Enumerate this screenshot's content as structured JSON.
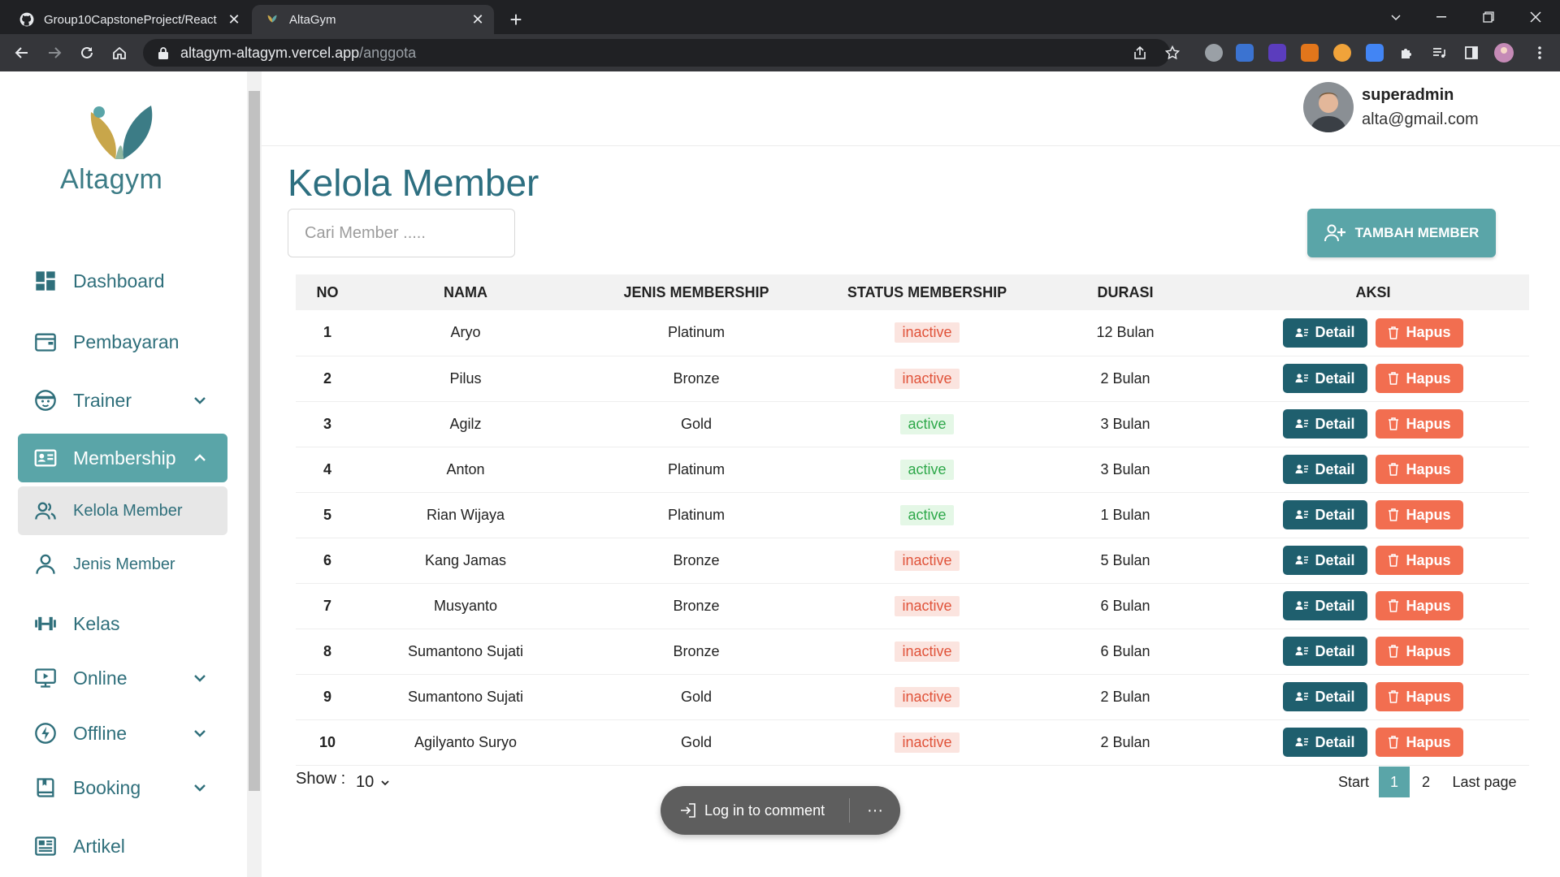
{
  "browser": {
    "tabs": [
      {
        "title": "Group10CapstoneProject/React",
        "active": false
      },
      {
        "title": "AltaGym",
        "active": true
      }
    ],
    "url_host": "altagym-altagym.vercel.app",
    "url_path": "/anggota"
  },
  "sidebar": {
    "brand": "Altagym",
    "items": [
      {
        "label": "Dashboard",
        "icon": "dashboard-icon"
      },
      {
        "label": "Pembayaran",
        "icon": "wallet-icon"
      },
      {
        "label": "Trainer",
        "icon": "trainer-face-icon"
      },
      {
        "label": "Membership",
        "icon": "id-card-icon"
      },
      {
        "label": "Kelola Member",
        "icon": "users-icon"
      },
      {
        "label": "Jenis Member",
        "icon": "user-icon"
      },
      {
        "label": "Kelas",
        "icon": "dumbbell-icon"
      },
      {
        "label": "Online",
        "icon": "monitor-icon"
      },
      {
        "label": "Offline",
        "icon": "bolt-icon"
      },
      {
        "label": "Booking",
        "icon": "book-icon"
      },
      {
        "label": "Artikel",
        "icon": "newspaper-icon"
      }
    ]
  },
  "user": {
    "name": "superadmin",
    "email": "alta@gmail.com"
  },
  "page": {
    "title": "Kelola Member",
    "search_placeholder": "Cari Member .....",
    "add_button": "TAMBAH MEMBER"
  },
  "table": {
    "headers": [
      "NO",
      "NAMA",
      "JENIS MEMBERSHIP",
      "STATUS MEMBERSHIP",
      "DURASI",
      "AKSI"
    ],
    "detail_label": "Detail",
    "hapus_label": "Hapus",
    "rows": [
      {
        "no": "1",
        "nama": "Aryo",
        "jenis": "Platinum",
        "status": "inactive",
        "durasi": "12 Bulan"
      },
      {
        "no": "2",
        "nama": "Pilus",
        "jenis": "Bronze",
        "status": "inactive",
        "durasi": "2 Bulan"
      },
      {
        "no": "3",
        "nama": "Agilz",
        "jenis": "Gold",
        "status": "active",
        "durasi": "3 Bulan"
      },
      {
        "no": "4",
        "nama": "Anton",
        "jenis": "Platinum",
        "status": "active",
        "durasi": "3 Bulan"
      },
      {
        "no": "5",
        "nama": "Rian Wijaya",
        "jenis": "Platinum",
        "status": "active",
        "durasi": "1 Bulan"
      },
      {
        "no": "6",
        "nama": "Kang Jamas",
        "jenis": "Bronze",
        "status": "inactive",
        "durasi": "5 Bulan"
      },
      {
        "no": "7",
        "nama": "Musyanto",
        "jenis": "Bronze",
        "status": "inactive",
        "durasi": "6 Bulan"
      },
      {
        "no": "8",
        "nama": "Sumantono Sujati",
        "jenis": "Bronze",
        "status": "inactive",
        "durasi": "6 Bulan"
      },
      {
        "no": "9",
        "nama": "Sumantono Sujati",
        "jenis": "Gold",
        "status": "inactive",
        "durasi": "2 Bulan"
      },
      {
        "no": "10",
        "nama": "Agilyanto Suryo",
        "jenis": "Gold",
        "status": "inactive",
        "durasi": "2 Bulan"
      }
    ]
  },
  "footer": {
    "show_label": "Show :",
    "show_value": "10",
    "pagination": {
      "start": "Start",
      "pages": [
        "1",
        "2"
      ],
      "current": "1",
      "last": "Last page"
    }
  },
  "comment": {
    "label": "Log in to comment",
    "more": "···"
  },
  "colors": {
    "accent": "#5aa5a8",
    "primary_dark": "#1f5f6e",
    "danger": "#f26e50",
    "title": "#2d6f80"
  }
}
